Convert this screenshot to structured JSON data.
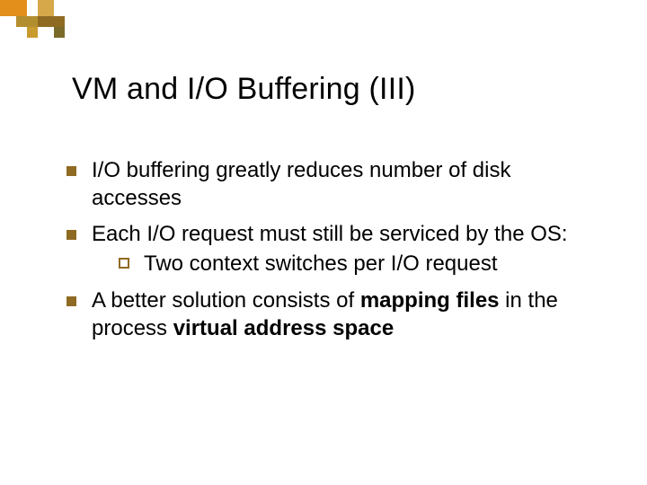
{
  "title": "VM and I/O Buffering (III)",
  "bullets": {
    "b1": "I/O buffering greatly reduces number of disk accesses",
    "b2": "Each I/O request must still be serviced by the OS:",
    "b2_sub": "Two context switches per I/O request",
    "b3_pre": "A better solution consists of ",
    "b3_bold1": "mapping files",
    "b3_mid": " in the process ",
    "b3_bold2": "virtual address space"
  }
}
